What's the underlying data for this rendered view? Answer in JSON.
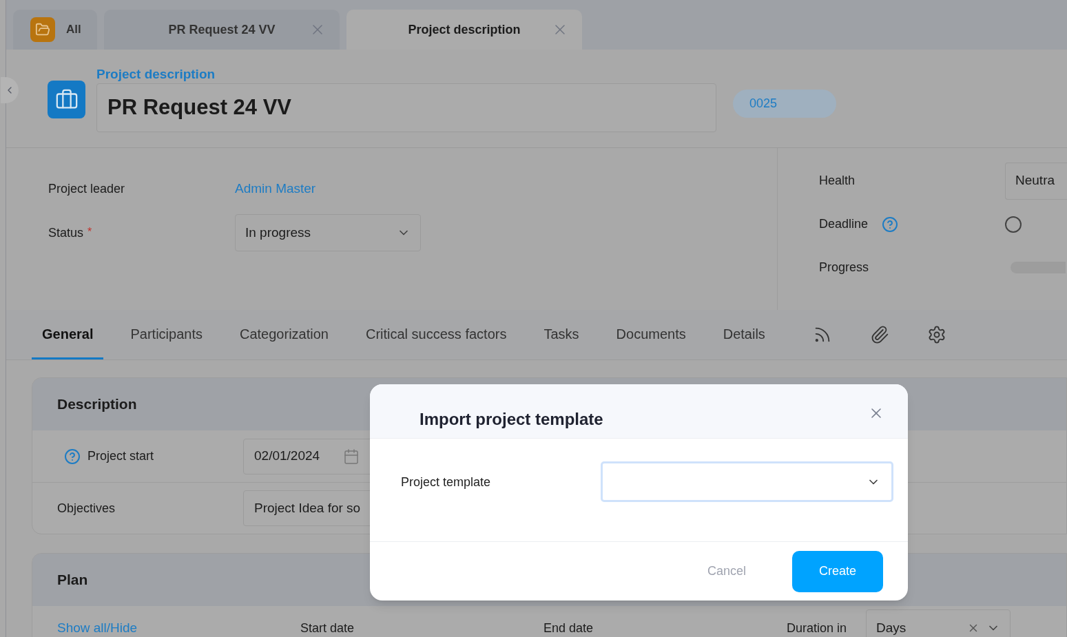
{
  "doc_tabs": [
    {
      "kind": "home",
      "label": "All",
      "selected": false
    },
    {
      "kind": "document",
      "label": "PR Request 24 VV",
      "selected": false
    },
    {
      "kind": "document",
      "label": "Project description",
      "selected": true
    }
  ],
  "header": {
    "caption": "Project description",
    "title": "PR Request 24 VV",
    "number": "0025"
  },
  "fields_left": [
    {
      "kind": "link",
      "label": "Project leader",
      "value": "Admin Master",
      "required": false
    },
    {
      "kind": "select",
      "label": "Status",
      "value": "In progress",
      "required": true,
      "required_mark": "*"
    }
  ],
  "fields_right": [
    {
      "kind": "select",
      "label": "Health",
      "value": "Neutra",
      "help": false
    },
    {
      "kind": "radio",
      "label": "Deadline",
      "checked": false,
      "help": true
    },
    {
      "kind": "progress",
      "label": "Progress",
      "level": 0,
      "help": false
    }
  ],
  "section_tabs": [
    {
      "label": "General",
      "selected": true
    },
    {
      "label": "Participants",
      "selected": false
    },
    {
      "label": "Categorization",
      "selected": false
    },
    {
      "label": "Critical success factors",
      "selected": false
    },
    {
      "label": "Tasks",
      "selected": false
    },
    {
      "label": "Documents",
      "selected": false
    },
    {
      "label": "Details",
      "selected": false
    }
  ],
  "description": {
    "title": "Description",
    "rows": [
      {
        "kind": "date",
        "label": "Project start",
        "help": true,
        "value": "02/01/2024"
      },
      {
        "kind": "text",
        "label": "Objectives",
        "help": false,
        "value": "Project Idea for so"
      }
    ]
  },
  "plan": {
    "title": "Plan",
    "show_all": "Show all/Hide",
    "columns": [
      "Start date",
      "End date",
      "Duration in"
    ],
    "duration_unit": "Days"
  },
  "modal": {
    "title": "Import project template",
    "field_label": "Project template",
    "cancel": "Cancel",
    "create": "Create"
  }
}
